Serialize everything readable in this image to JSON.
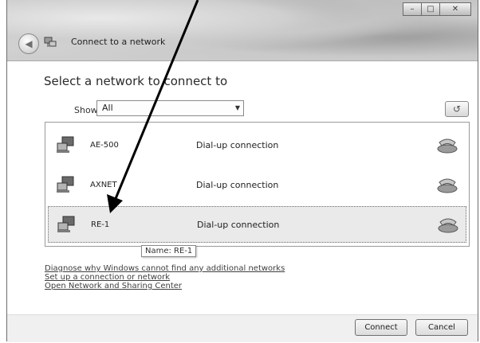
{
  "window": {
    "title": "Connect to a network",
    "controls": [
      "minimize",
      "maximize",
      "close"
    ]
  },
  "header": {
    "heading": "Select a network to connect to"
  },
  "filter": {
    "label": "Show",
    "selected": "All"
  },
  "networks": [
    {
      "name": "AE-500",
      "type": "Dial-up connection",
      "selected": false
    },
    {
      "name": "AXNET",
      "type": "Dial-up connection",
      "selected": false
    },
    {
      "name": "RE-1",
      "type": "Dial-up connection",
      "selected": true
    }
  ],
  "tooltip": "Name: RE-1",
  "links": [
    "Diagnose why Windows cannot find any additional networks",
    "Set up a connection or network",
    "Open Network and Sharing Center"
  ],
  "buttons": {
    "connect": "Connect",
    "cancel": "Cancel"
  },
  "icons": {
    "back": "back-arrow-icon",
    "title": "network-icon",
    "refresh": "refresh-icon",
    "network": "computer-network-icon",
    "dialup": "telephone-icon"
  }
}
